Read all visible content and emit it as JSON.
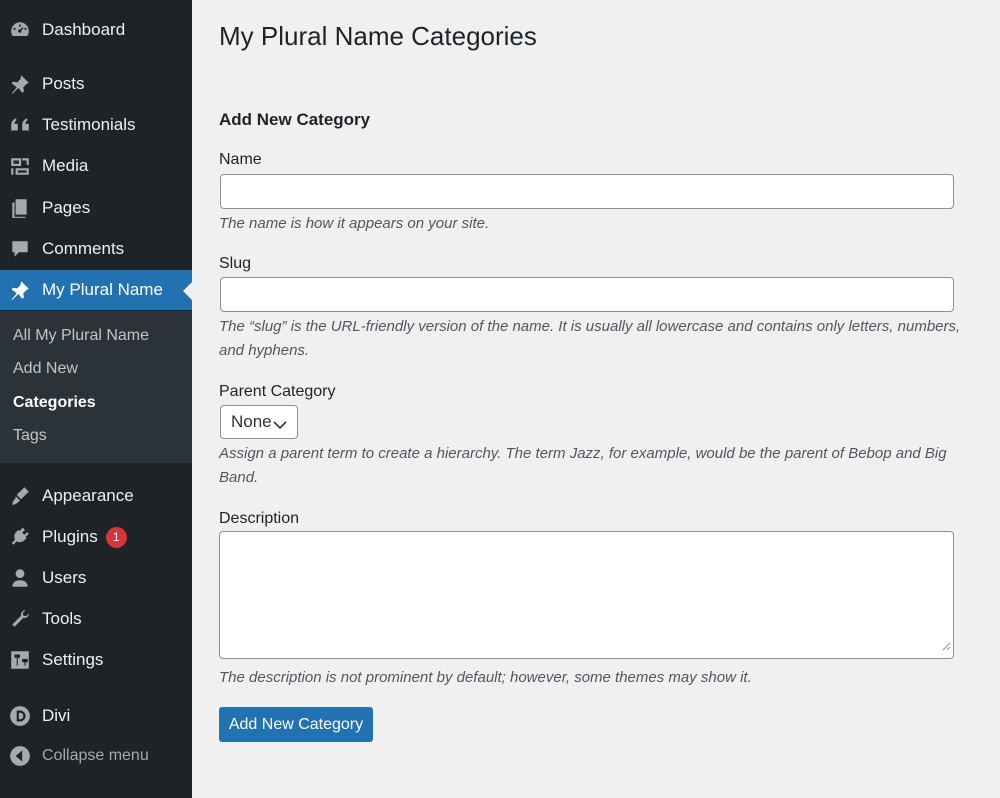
{
  "sidebar": {
    "items": [
      {
        "label": "Dashboard",
        "icon": "dashboard-icon"
      },
      {
        "label": "Posts",
        "icon": "pin-icon"
      },
      {
        "label": "Testimonials",
        "icon": "quote-icon"
      },
      {
        "label": "Media",
        "icon": "media-icon"
      },
      {
        "label": "Pages",
        "icon": "pages-icon"
      },
      {
        "label": "Comments",
        "icon": "comment-icon"
      },
      {
        "label": "My Plural Name",
        "icon": "pin-icon"
      },
      {
        "label": "Appearance",
        "icon": "brush-icon"
      },
      {
        "label": "Plugins",
        "icon": "plug-icon",
        "badge": "1"
      },
      {
        "label": "Users",
        "icon": "user-icon"
      },
      {
        "label": "Tools",
        "icon": "wrench-icon"
      },
      {
        "label": "Settings",
        "icon": "settings-icon"
      },
      {
        "label": "Divi",
        "icon": "divi-icon"
      }
    ],
    "submenu": [
      {
        "label": "All My Plural Name"
      },
      {
        "label": "Add New"
      },
      {
        "label": "Categories"
      },
      {
        "label": "Tags"
      }
    ],
    "collapse_label": "Collapse menu",
    "accent_color": "#2271b1"
  },
  "main": {
    "page_title": "My Plural Name Categories",
    "section_title": "Add New Category",
    "name": {
      "label": "Name",
      "value": "",
      "help": "The name is how it appears on your site."
    },
    "slug": {
      "label": "Slug",
      "value": "",
      "help": "The “slug” is the URL-friendly version of the name. It is usually all lowercase and contains only letters, numbers, and hyphens."
    },
    "parent": {
      "label": "Parent Category",
      "selected": "None",
      "help": "Assign a parent term to create a hierarchy. The term Jazz, for example, would be the parent of Bebop and Big Band."
    },
    "description": {
      "label": "Description",
      "value": "",
      "help": "The description is not prominent by default; however, some themes may show it."
    },
    "submit_label": "Add New Category"
  }
}
